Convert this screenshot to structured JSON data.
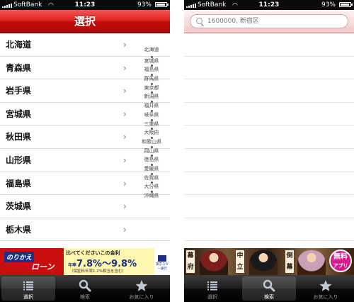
{
  "status_bar": {
    "carrier": "SoftBank",
    "time": "11:23",
    "battery": "93%",
    "battery_level": 0.93
  },
  "left_screen": {
    "title": "選択",
    "prefectures": [
      "北海道",
      "青森県",
      "岩手県",
      "宮城県",
      "秋田県",
      "山形県",
      "福島県",
      "茨城県",
      "栃木県"
    ],
    "index": [
      "北海道",
      "宮城県",
      "福島県",
      "群馬県",
      "東京都",
      "新潟県",
      "福井県",
      "岐阜県",
      "三重県",
      "大阪府",
      "和歌山県",
      "岡山県",
      "徳島県",
      "愛媛県",
      "佐賀県",
      "大分県",
      "沖縄県"
    ],
    "ad": {
      "left_line1": "のりかえ",
      "left_line2": "ローン",
      "headline": "比べてくださいこの金利",
      "rate_prefix": "年率",
      "rate": "7.8%～9.8%",
      "note": "（保証料年率1.2%相当を含む）",
      "bank": "東京スター銀行"
    }
  },
  "right_screen": {
    "search_placeholder": "1600000, 新宿区",
    "ad": {
      "tags": [
        "幕府",
        "中立",
        "倒幕"
      ],
      "badge_line1": "無料",
      "badge_line2": "アプリ"
    }
  },
  "tab_bar": {
    "tabs": [
      {
        "label": "選択",
        "icon": "list-icon"
      },
      {
        "label": "検索",
        "icon": "search-icon"
      },
      {
        "label": "お気に入り",
        "icon": "star-icon"
      }
    ],
    "left_selected": "選択",
    "right_selected": "検索"
  },
  "colors": {
    "navbar_red": "#d41616",
    "tab_bar": "#1a1a1a",
    "loan_blue": "#1c2f86",
    "badge_pink": "#d81a8c"
  }
}
